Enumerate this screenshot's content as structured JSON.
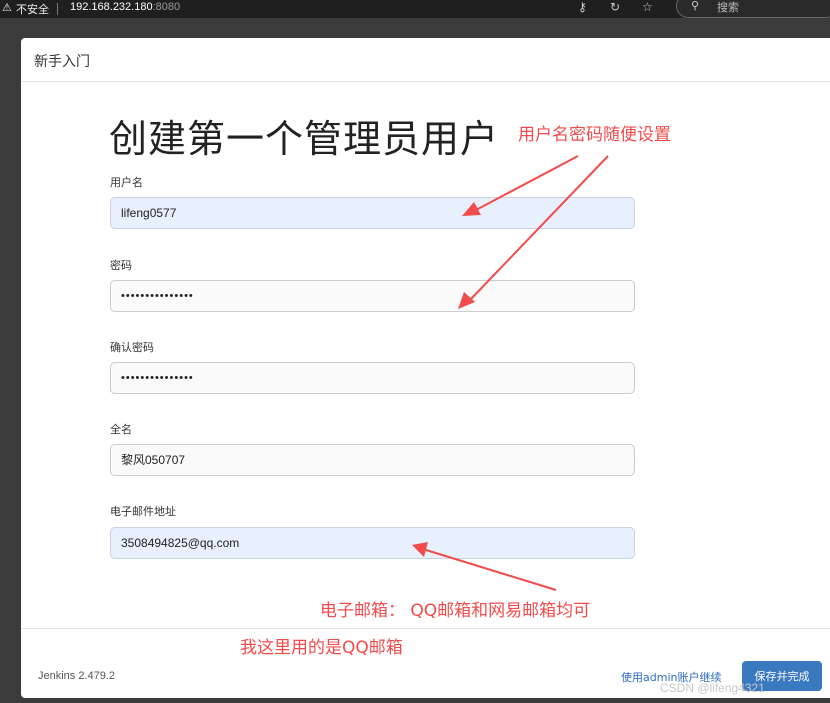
{
  "browser": {
    "security_label": "不安全",
    "address_host": "192.168.232.180",
    "address_port": ":8080",
    "search_placeholder": "搜索",
    "icons": [
      "warning-icon",
      "key-icon",
      "refresh-icon",
      "star-icon",
      "search-icon"
    ]
  },
  "panel": {
    "header_title": "新手入门",
    "form_title": "创建第一个管理员用户",
    "fields": [
      {
        "label": "用户名",
        "value": "lifeng0577"
      },
      {
        "label": "密码",
        "value": "•••••••••••••••"
      },
      {
        "label": "确认密码",
        "value": "•••••••••••••••"
      },
      {
        "label": "全名",
        "value": "黎风050707"
      },
      {
        "label": "电子邮件地址",
        "value": "3508494825@qq.com"
      }
    ],
    "footer": {
      "version": "Jenkins 2.479.2",
      "continue_label": "使用admin账户继续",
      "save_label": "保存并完成"
    }
  },
  "annotations": {
    "credentials_note": "用户名密码随便设置",
    "email_note": "电子邮箱： QQ邮箱和网易邮箱均可",
    "qq_note": "我这里用的是QQ邮箱",
    "color": "#f24b4b"
  },
  "watermark": "CSDN @lifeng4321"
}
